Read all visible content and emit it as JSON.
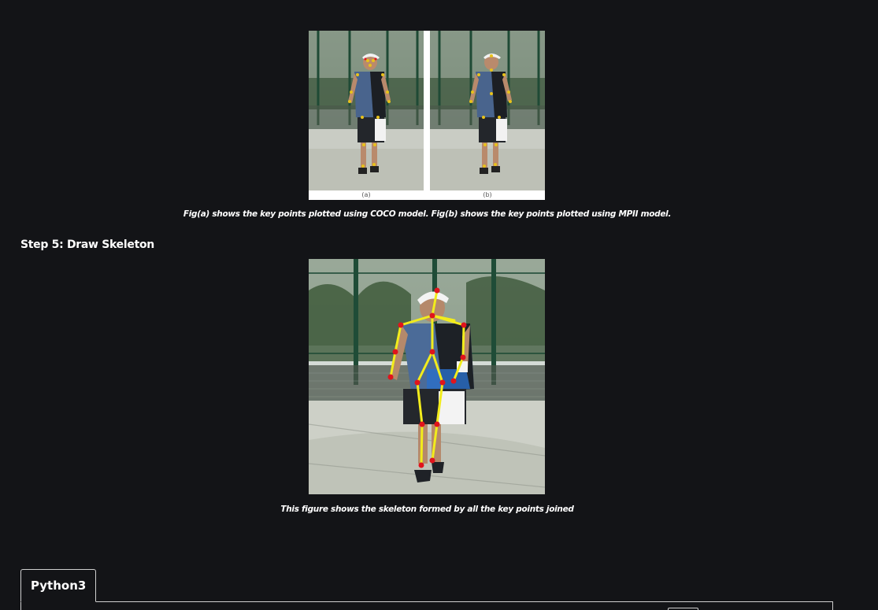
{
  "figures": {
    "comparison": {
      "label_a": "(a)",
      "label_b": "(b)",
      "caption": "Fig(a) shows the key points plotted using COCO model. Fig(b) shows the key points plotted using MPII model."
    },
    "skeleton": {
      "caption": "This figure shows the skeleton formed by all the key points joined"
    }
  },
  "step": {
    "heading": "Step 5: Draw Skeleton"
  },
  "code": {
    "tab_label": "Python3"
  },
  "colors": {
    "page_bg": "#131417",
    "keypoint": "#e0141c",
    "skeleton_line": "#f2ec1c"
  }
}
